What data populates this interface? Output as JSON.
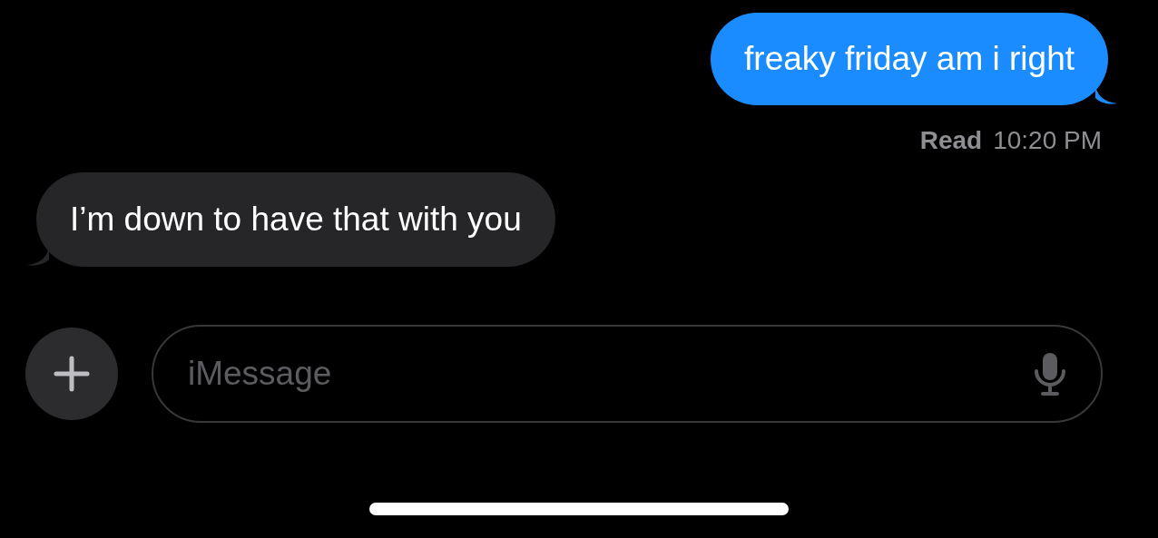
{
  "messages": [
    {
      "kind": "sent",
      "text": "freaky friday am i right"
    },
    {
      "kind": "received",
      "text": "I’m down to have that with you"
    }
  ],
  "receipt": {
    "status": "Read",
    "time": "10:20 PM"
  },
  "composer": {
    "placeholder": "iMessage"
  }
}
